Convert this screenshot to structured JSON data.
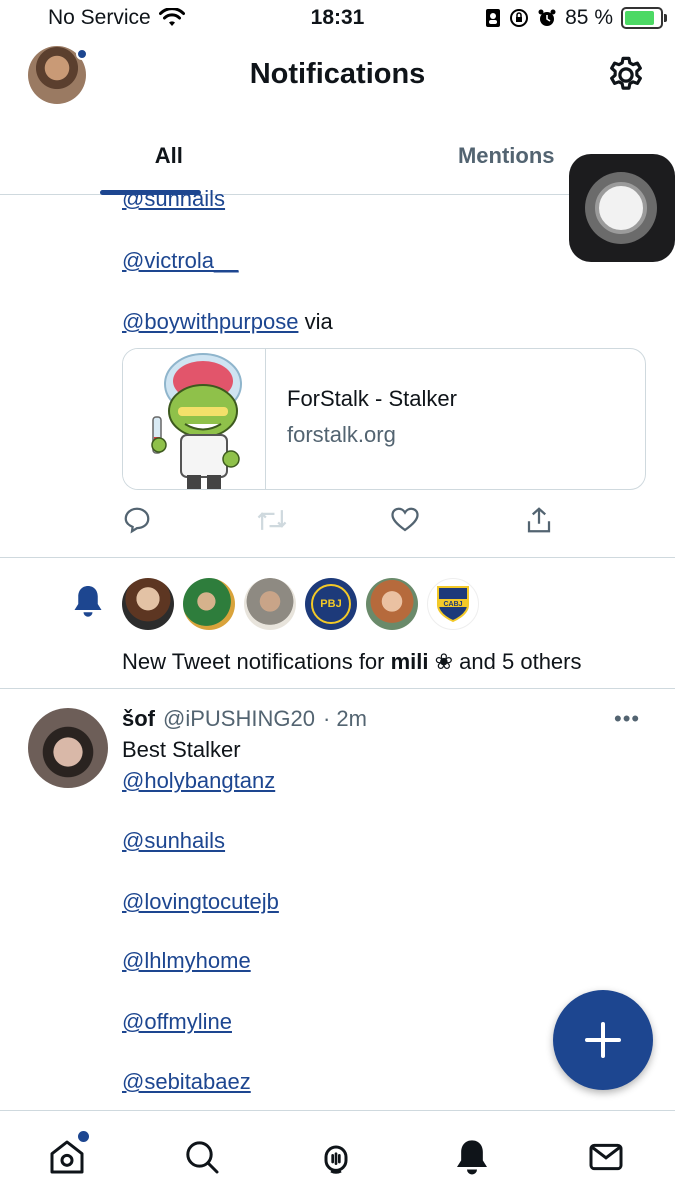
{
  "status_bar": {
    "carrier": "No Service",
    "time": "18:31",
    "battery": "85 %",
    "battery_level": 0.85
  },
  "header": {
    "title": "Notifications"
  },
  "tabs": [
    {
      "label": "All",
      "active": true
    },
    {
      "label": "Mentions",
      "active": false
    }
  ],
  "previous_tweet": {
    "mentions": [
      "@sunhails",
      "@victrola__",
      "@boywithpurpose"
    ],
    "via_text": "via",
    "card": {
      "title": "ForStalk - Stalker",
      "domain": "forstalk.org"
    },
    "actions": [
      "reply-icon",
      "retweet-icon",
      "like-icon",
      "share-icon"
    ]
  },
  "notification_group": {
    "text_prefix": "New Tweet notifications for ",
    "bold_name": "mili ❀",
    "text_suffix": " and 5 others",
    "avatar_count": 6,
    "badge_label": "PBJ",
    "club_label": "CABJ"
  },
  "tweet": {
    "name": "šof",
    "handle": "@iPUSHING20",
    "time": "· 2m",
    "text": "Best Stalker",
    "mentions": [
      "@holybangtanz",
      "@sunhails",
      "@lovingtocutejb",
      "@lhlmyhome",
      "@offmyline",
      "@sebitabaez"
    ],
    "more": "•••"
  },
  "colors": {
    "accent": "#1d4690",
    "text": "#0f1419",
    "muted": "#536471",
    "border": "#cfd9de"
  },
  "bottom_nav": [
    "home-icon",
    "search-icon",
    "spaces-icon",
    "notifications-icon",
    "messages-icon"
  ]
}
